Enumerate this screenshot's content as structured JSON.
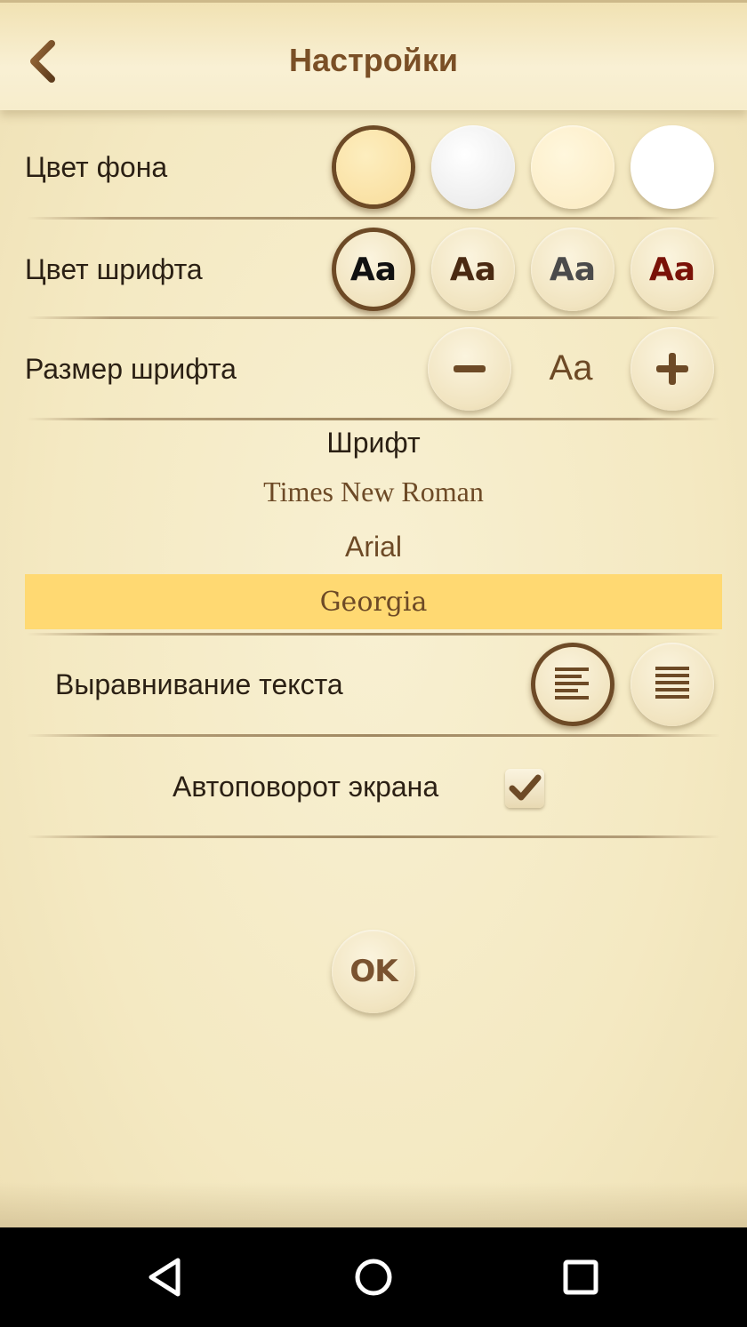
{
  "header": {
    "title": "Настройки",
    "back_icon": "arrow-left-icon"
  },
  "background_color": {
    "label": "Цвет фона",
    "options": [
      {
        "name": "sand",
        "color": "#fbe3a8",
        "selected": true
      },
      {
        "name": "silver",
        "color": "#efefef",
        "selected": false
      },
      {
        "name": "cream",
        "color": "#fdf0c9",
        "selected": false
      },
      {
        "name": "white",
        "color": "#ffffff",
        "selected": false
      }
    ]
  },
  "font_color": {
    "label": "Цвет шрифта",
    "sample": "Aa",
    "options": [
      {
        "name": "black",
        "color": "#111111",
        "selected": true
      },
      {
        "name": "dark-brown",
        "color": "#4a2a12",
        "selected": false
      },
      {
        "name": "gray",
        "color": "#4b4b4b",
        "selected": false
      },
      {
        "name": "dark-red",
        "color": "#7a1208",
        "selected": false
      }
    ]
  },
  "font_size": {
    "label": "Размер шрифта",
    "sample": "Aa",
    "decrease_icon": "minus-icon",
    "increase_icon": "plus-icon"
  },
  "font": {
    "heading": "Шрифт",
    "options": [
      {
        "label": "Times New Roman",
        "selected": false
      },
      {
        "label": "Arial",
        "selected": false
      },
      {
        "label": "Georgia",
        "selected": true
      }
    ]
  },
  "alignment": {
    "label": "Выравнивание текста",
    "options": [
      {
        "name": "align-left-icon",
        "selected": true
      },
      {
        "name": "align-justify-icon",
        "selected": false
      }
    ]
  },
  "autorotate": {
    "label": "Автоповорот экрана",
    "checked": true
  },
  "ok_button": {
    "label": "OK"
  },
  "colors": {
    "accent_brown": "#7a4f26",
    "selected_font_highlight": "#ffd972"
  },
  "navbar": {
    "icons": [
      "back-triangle-icon",
      "home-circle-icon",
      "recents-square-icon"
    ]
  }
}
